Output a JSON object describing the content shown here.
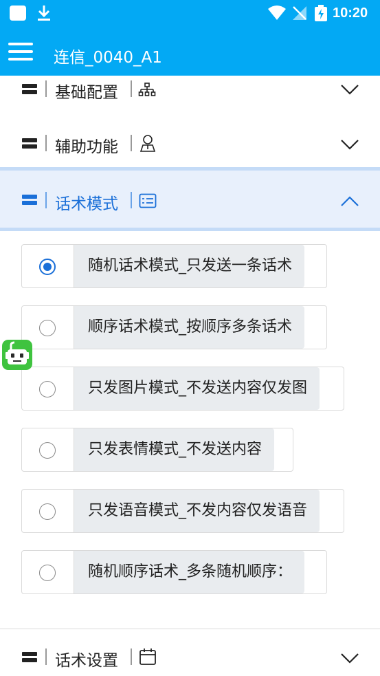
{
  "statusbar": {
    "time": "10:20"
  },
  "appbar": {
    "title": "连信_0040_A1"
  },
  "sections": {
    "basic": {
      "label": "基础配置",
      "icon": "sitemap-icon",
      "expanded": false
    },
    "assist": {
      "label": "辅助功能",
      "icon": "user-icon",
      "expanded": false
    },
    "script_mode": {
      "label": "话术模式",
      "icon": "id-card-icon",
      "expanded": true
    },
    "script_settings": {
      "label": "话术设置",
      "icon": "calendar-icon",
      "expanded": false
    }
  },
  "options": [
    {
      "label": "随机话术模式_只发送一条话术",
      "selected": true
    },
    {
      "label": "顺序话术模式_按顺序多条话术",
      "selected": false
    },
    {
      "label": "只发图片模式_不发送内容仅发图",
      "selected": false
    },
    {
      "label": "只发表情模式_不发送内容",
      "selected": false
    },
    {
      "label": "只发语音模式_不发内容仅发语音",
      "selected": false
    },
    {
      "label": "随机顺序话术_多条随机顺序：",
      "selected": false
    }
  ],
  "colors": {
    "appbar": "#03a9f4",
    "accent": "#1a6fd8",
    "active_bg": "#e8f0fc",
    "option_bg": "#e9ecef",
    "robot": "#3fc33f"
  }
}
